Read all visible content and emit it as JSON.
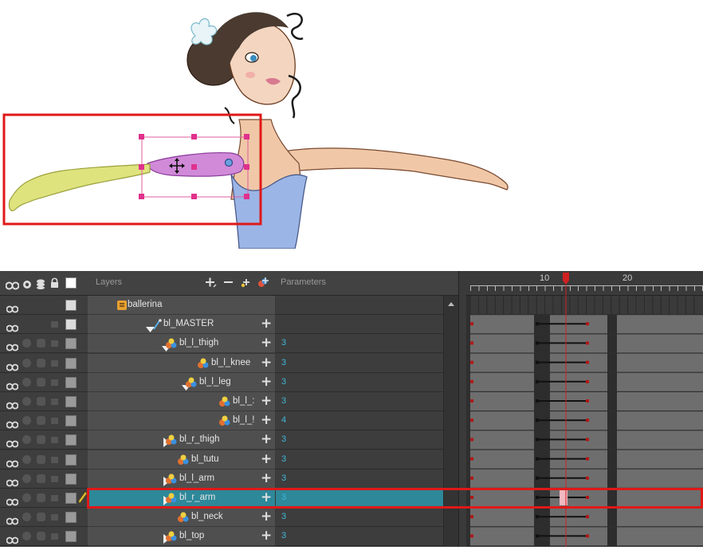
{
  "header": {
    "layers_label": "Layers",
    "parameters_label": "Parameters",
    "frame_10": "10",
    "frame_20": "20"
  },
  "layers": [
    {
      "name": "ballerina",
      "param": ""
    },
    {
      "name": "bl_MASTER",
      "param": ""
    },
    {
      "name": "bl_l_thigh",
      "param": "3"
    },
    {
      "name": "bl_l_knee",
      "param": "3"
    },
    {
      "name": "bl_l_leg",
      "param": "3"
    },
    {
      "name": "bl_l_:",
      "param": "3"
    },
    {
      "name": "bl_l_!",
      "param": "4"
    },
    {
      "name": "bl_r_thigh",
      "param": "3"
    },
    {
      "name": "bl_tutu",
      "param": "3"
    },
    {
      "name": "bl_l_arm",
      "param": "3"
    },
    {
      "name": "bl_r_arm",
      "param": "3"
    },
    {
      "name": "bl_neck",
      "param": "3"
    },
    {
      "name": "bl_top",
      "param": "3"
    }
  ],
  "selected_layer": "bl_r_arm",
  "colors": {
    "selection": "#2d8899",
    "highlight_border": "#e01818",
    "param_text": "#3fb7d8",
    "playhead": "#d02020"
  },
  "icons": {
    "header": [
      "eye-pair-icon",
      "solo-icon",
      "stack-icon",
      "lock-icon",
      "color-swatch-icon",
      "add-layer-icon",
      "remove-layer-icon",
      "add-peg-icon",
      "add-drawing-icon"
    ],
    "layer": [
      "drawing-layer-icon",
      "peg-icon",
      "group-icon",
      "expand-triangle-icon",
      "add-param-icon",
      "pencil-icon"
    ]
  }
}
